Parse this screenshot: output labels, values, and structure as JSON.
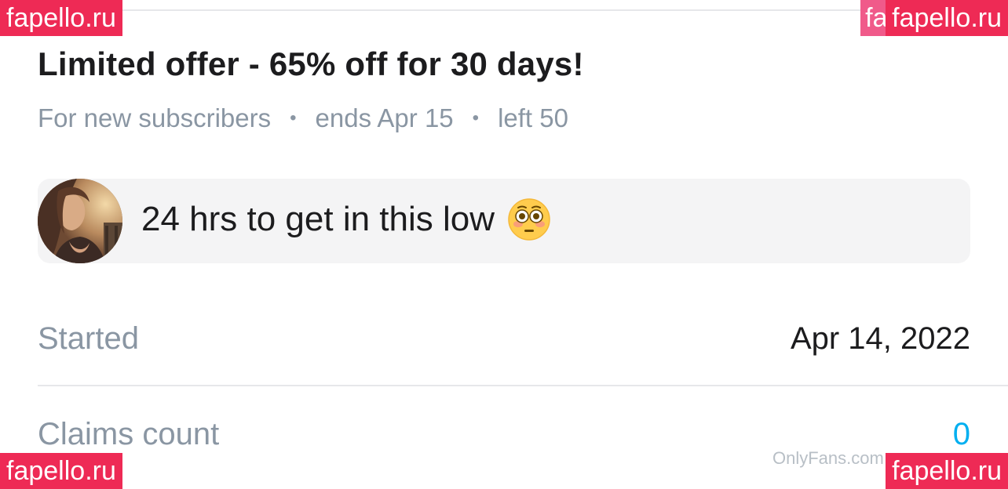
{
  "offer": {
    "title": "Limited offer - 65% off for 30 days!",
    "audience": "For new subscribers",
    "ends": "ends Apr 15",
    "left": "left 50"
  },
  "message": {
    "text": "24 hrs to get in this low",
    "emoji": "flushed-face"
  },
  "details": {
    "started_label": "Started",
    "started_value": "Apr 14, 2022",
    "claims_label": "Claims count",
    "claims_value": "0"
  },
  "overlays": {
    "badge_text": "fapello.ru",
    "badge_partial": "fa",
    "site_watermark": "OnlyFans.com"
  },
  "colors": {
    "title": "#1c1c1e",
    "muted": "#8a96a3",
    "accent": "#00aff0",
    "message_bg": "#f4f4f5",
    "badge_bg": "#ee2a55"
  }
}
